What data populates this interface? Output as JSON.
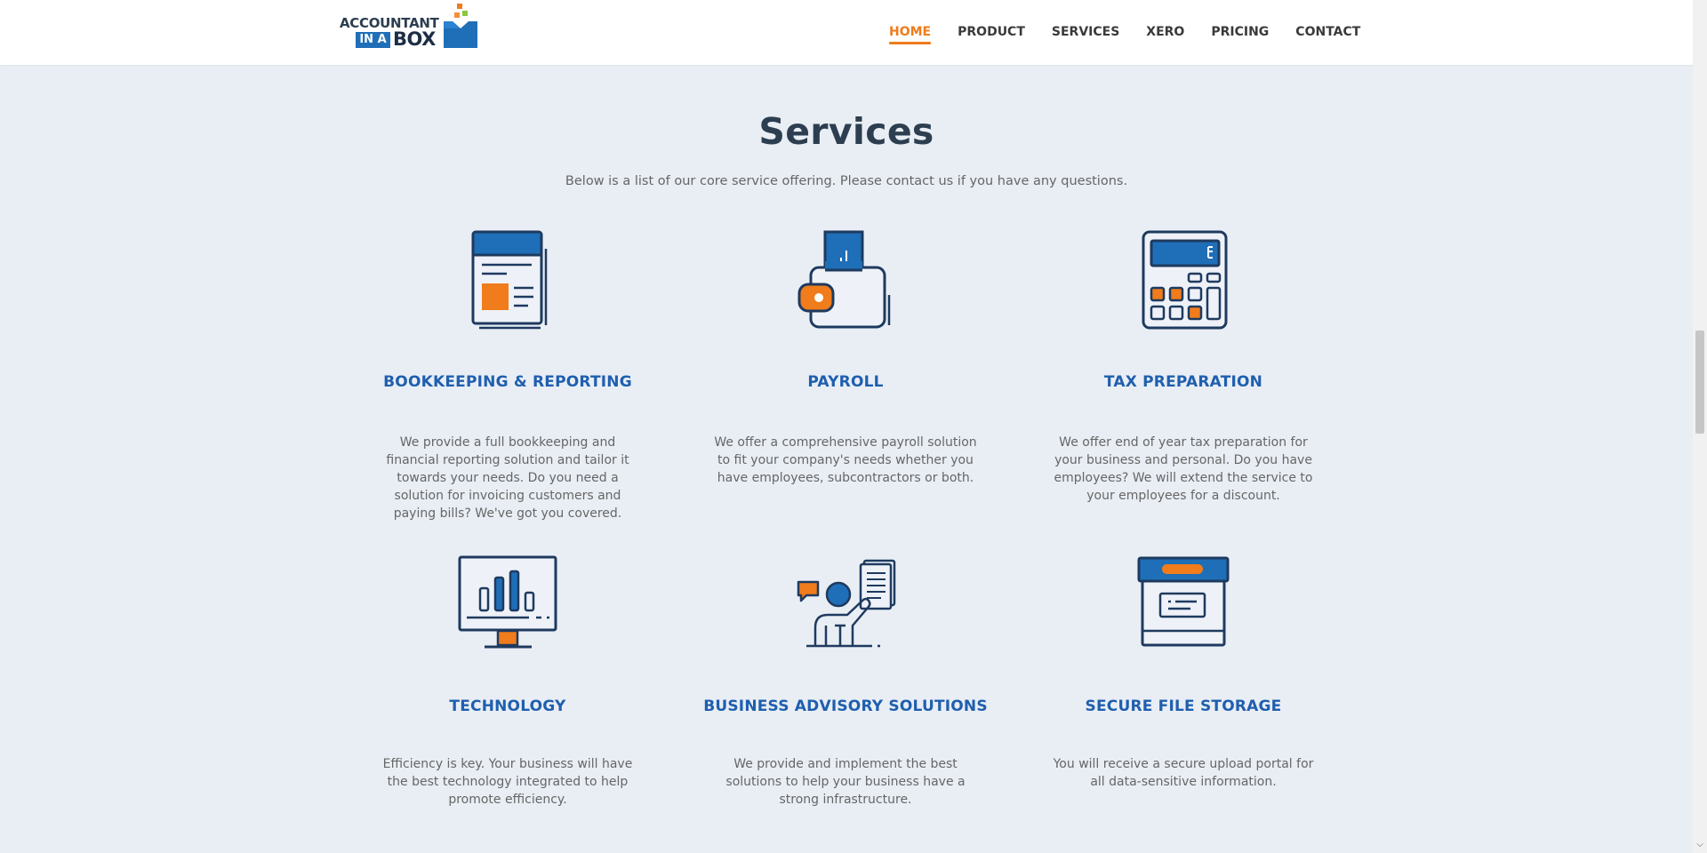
{
  "brand": {
    "line1": "ACCOUNTANT",
    "badge": "IN A",
    "line2": "BOX",
    "colors": {
      "blue": "#1f6fb8",
      "orange": "#f07c1b",
      "green": "#8dc63f",
      "navy": "#1e3a5f"
    }
  },
  "nav": {
    "items": [
      {
        "label": "HOME",
        "active": true
      },
      {
        "label": "PRODUCT",
        "active": false
      },
      {
        "label": "SERVICES",
        "active": false
      },
      {
        "label": "XERO",
        "active": false
      },
      {
        "label": "PRICING",
        "active": false
      },
      {
        "label": "CONTACT",
        "active": false
      }
    ]
  },
  "main": {
    "title": "Services",
    "subtitle": "Below is a list of our core service offering. Please contact us if you have any questions."
  },
  "services": [
    {
      "icon": "newspaper-icon",
      "title": "BOOKKEEPING & REPORTING",
      "description": "We provide a full bookkeeping and financial reporting solution and tailor it towards your needs. Do you need a solution for invoicing customers and paying bills? We've got you covered."
    },
    {
      "icon": "wallet-icon",
      "title": "PAYROLL",
      "description": "We offer a comprehensive payroll solution to fit your company's needs whether you have employees, subcontractors or both."
    },
    {
      "icon": "calculator-icon",
      "title": "TAX PREPARATION",
      "description": "We offer end of year tax preparation for your business and personal. Do you have employees? We will extend the service to your employees for a discount."
    },
    {
      "icon": "monitor-chart-icon",
      "title": "TECHNOLOGY",
      "description": "Efficiency is key. Your business will have the best technology integrated to help promote efficiency."
    },
    {
      "icon": "advisor-icon",
      "title": "BUSINESS ADVISORY SOLUTIONS",
      "description": "We provide and implement the best solutions to help your business have a strong infrastructure."
    },
    {
      "icon": "archive-box-icon",
      "title": "SECURE FILE STORAGE",
      "description": "You will receive a secure upload portal for all data-sensitive information."
    }
  ]
}
